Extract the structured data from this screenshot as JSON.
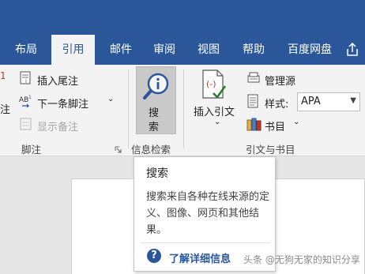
{
  "tabs": [
    {
      "label": "布局",
      "active": false
    },
    {
      "label": "引用",
      "active": true
    },
    {
      "label": "邮件",
      "active": false
    },
    {
      "label": "审阅",
      "active": false
    },
    {
      "label": "视图",
      "active": false
    },
    {
      "label": "帮助",
      "active": false
    },
    {
      "label": "百度网盘",
      "active": false
    }
  ],
  "ribbon": {
    "footnotes": {
      "insert_endnote": "插入尾注",
      "next_footnote": "下一条脚注",
      "show_notes": "显示备注",
      "partial_label": "注",
      "group_name": "脚注"
    },
    "research": {
      "search_label": "搜\n索",
      "search_line1": "搜",
      "search_line2": "索",
      "group_name": "信息检索"
    },
    "citations": {
      "insert_citation_line1": "插入引文",
      "manage_sources": "管理源",
      "style_label": "样式:",
      "style_value": "APA",
      "bibliography": "书目",
      "group_name": "引文与书目"
    }
  },
  "tooltip": {
    "title": "搜索",
    "description": "搜索来自各种在线来源的定义、图像、网页和其他结果。",
    "link": "了解详细信息"
  },
  "watermark": "头条 @无狗无家的知识分享",
  "colors": {
    "accent": "#2b579a",
    "ribbon_bg": "#f3f3f3",
    "pressed_button": "#c9c9c9"
  }
}
